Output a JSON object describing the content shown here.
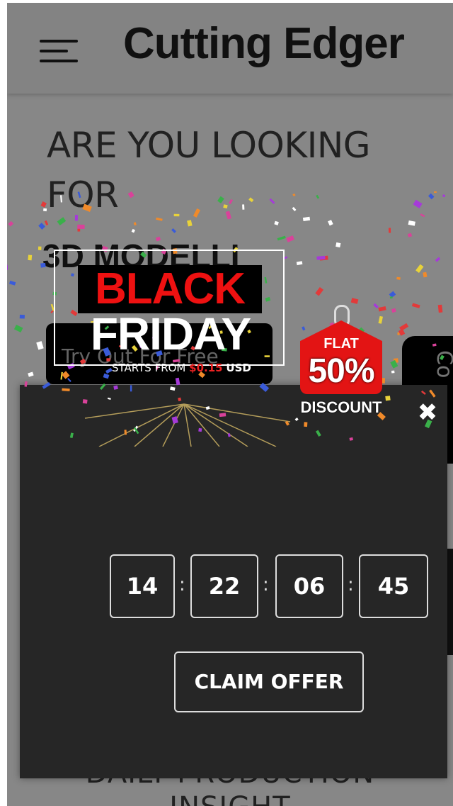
{
  "header": {
    "brand": "Cutting Edger",
    "menu_icon": "hamburger-menu-icon"
  },
  "hero": {
    "heading": "ARE YOU LOOKING FOR",
    "subheading": "3D MODELLI",
    "cta_left": "Try Out For Free",
    "cta_right": "Co"
  },
  "footer": {
    "line1": "DAILY PRODUCTION",
    "line2": "INSIGHT"
  },
  "promo": {
    "black": "BLACK",
    "friday": "FRIDAY",
    "starts_from": "STARTS FROM",
    "price": "$0.15",
    "currency": "USD",
    "tag_flat": "FLAT",
    "tag_percent": "50%",
    "tag_discount": "DISCOUNT",
    "close_icon": "close-icon"
  },
  "countdown": {
    "days": "14",
    "hours": "22",
    "minutes": "06",
    "seconds": "45",
    "separator": ":"
  },
  "claim_button": "CLAIM OFFER",
  "colors": {
    "modal_bg": "#262626",
    "dimmed_page": "#8a8a8a",
    "tag_red": "#e31414",
    "black_text_red": "#ee1111"
  }
}
